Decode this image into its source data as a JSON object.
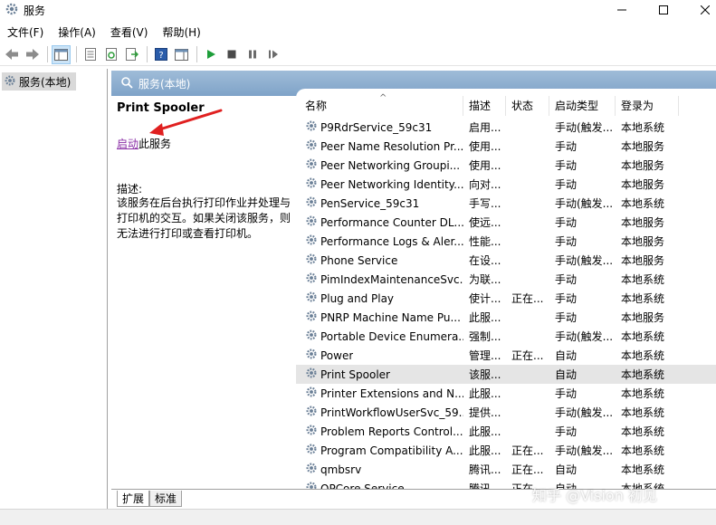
{
  "window": {
    "title": "服务"
  },
  "menu": [
    {
      "label": "文件(F)"
    },
    {
      "label": "操作(A)"
    },
    {
      "label": "查看(V)"
    },
    {
      "label": "帮助(H)"
    }
  ],
  "tree": {
    "root_label": "服务(本地)"
  },
  "panel": {
    "title": "服务(本地)"
  },
  "detail": {
    "service_name": "Print Spooler",
    "start_link": "启动",
    "start_suffix": "此服务",
    "desc_label": "描述:",
    "desc_text": "该服务在后台执行打印作业并处理与打印机的交互。如果关闭该服务，则无法进行打印或查看打印机。"
  },
  "columns": {
    "name": "名称",
    "desc": "描述",
    "status": "状态",
    "start_type": "启动类型",
    "logon": "登录为"
  },
  "services": [
    {
      "name": "P9RdrService_59c31",
      "desc": "启用...",
      "status": "",
      "start_type": "手动(触发...",
      "logon": "本地系统"
    },
    {
      "name": "Peer Name Resolution Pr...",
      "desc": "使用...",
      "status": "",
      "start_type": "手动",
      "logon": "本地服务"
    },
    {
      "name": "Peer Networking Groupi...",
      "desc": "使用...",
      "status": "",
      "start_type": "手动",
      "logon": "本地服务"
    },
    {
      "name": "Peer Networking Identity...",
      "desc": "向对...",
      "status": "",
      "start_type": "手动",
      "logon": "本地服务"
    },
    {
      "name": "PenService_59c31",
      "desc": "手写...",
      "status": "",
      "start_type": "手动(触发...",
      "logon": "本地系统"
    },
    {
      "name": "Performance Counter DL...",
      "desc": "使远...",
      "status": "",
      "start_type": "手动",
      "logon": "本地服务"
    },
    {
      "name": "Performance Logs & Aler...",
      "desc": "性能...",
      "status": "",
      "start_type": "手动",
      "logon": "本地服务"
    },
    {
      "name": "Phone Service",
      "desc": "在设...",
      "status": "",
      "start_type": "手动(触发...",
      "logon": "本地服务"
    },
    {
      "name": "PimIndexMaintenanceSvc...",
      "desc": "为联...",
      "status": "",
      "start_type": "手动",
      "logon": "本地系统"
    },
    {
      "name": "Plug and Play",
      "desc": "使计...",
      "status": "正在...",
      "start_type": "手动",
      "logon": "本地系统"
    },
    {
      "name": "PNRP Machine Name Pu...",
      "desc": "此服...",
      "status": "",
      "start_type": "手动",
      "logon": "本地服务"
    },
    {
      "name": "Portable Device Enumera...",
      "desc": "强制...",
      "status": "",
      "start_type": "手动(触发...",
      "logon": "本地系统"
    },
    {
      "name": "Power",
      "desc": "管理...",
      "status": "正在...",
      "start_type": "自动",
      "logon": "本地系统"
    },
    {
      "name": "Print Spooler",
      "desc": "该服...",
      "status": "",
      "start_type": "自动",
      "logon": "本地系统",
      "selected": true
    },
    {
      "name": "Printer Extensions and N...",
      "desc": "此服...",
      "status": "",
      "start_type": "手动",
      "logon": "本地系统"
    },
    {
      "name": "PrintWorkflowUserSvc_59...",
      "desc": "提供...",
      "status": "",
      "start_type": "手动(触发...",
      "logon": "本地系统"
    },
    {
      "name": "Problem Reports Control...",
      "desc": "此服...",
      "status": "",
      "start_type": "手动",
      "logon": "本地系统"
    },
    {
      "name": "Program Compatibility A...",
      "desc": "此服...",
      "status": "正在...",
      "start_type": "手动(触发...",
      "logon": "本地系统"
    },
    {
      "name": "qmbsrv",
      "desc": "腾讯...",
      "status": "正在...",
      "start_type": "自动",
      "logon": "本地系统"
    },
    {
      "name": "QPCore Service",
      "desc": "腾讯...",
      "status": "正在...",
      "start_type": "自动",
      "logon": "本地系统"
    }
  ],
  "tabs": [
    {
      "label": "扩展"
    },
    {
      "label": "标准"
    }
  ],
  "watermark": "知乎 @Vision 初见",
  "colors": {
    "header_blue": "#8fb0d2",
    "link_purple": "#8a2ea6",
    "arrow_red": "#e02020"
  }
}
